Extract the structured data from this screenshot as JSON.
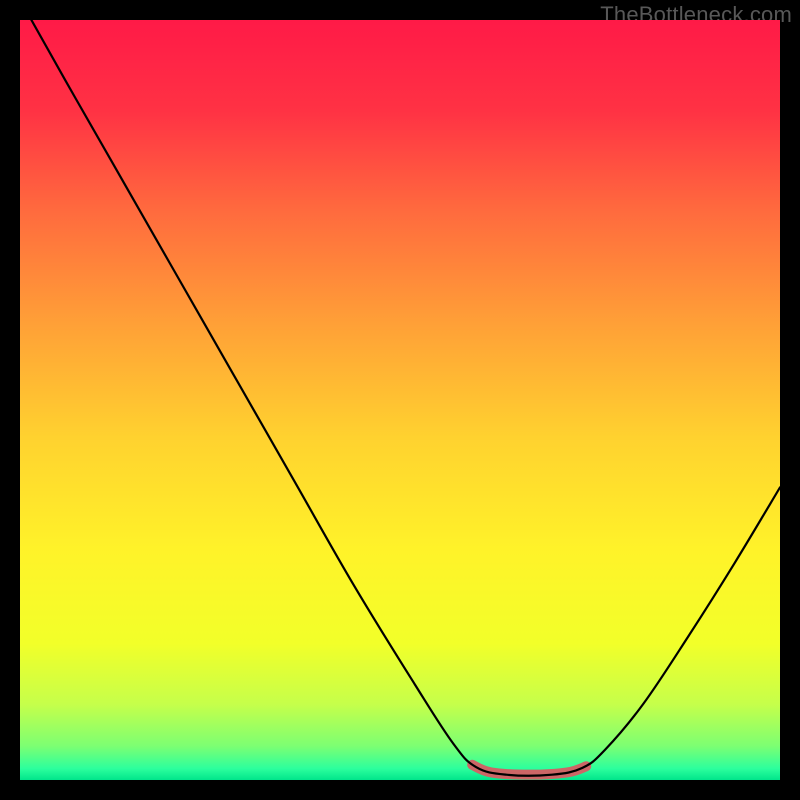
{
  "watermark": "TheBottleneck.com",
  "chart_data": {
    "type": "line",
    "title": "",
    "xlabel": "",
    "ylabel": "",
    "xlim": [
      0,
      100
    ],
    "ylim": [
      0,
      100
    ],
    "background_gradient": {
      "stops": [
        {
          "offset": 0.0,
          "color": "#ff1a47"
        },
        {
          "offset": 0.12,
          "color": "#ff3244"
        },
        {
          "offset": 0.25,
          "color": "#ff6a3e"
        },
        {
          "offset": 0.4,
          "color": "#ffa037"
        },
        {
          "offset": 0.55,
          "color": "#ffd22f"
        },
        {
          "offset": 0.7,
          "color": "#fff329"
        },
        {
          "offset": 0.82,
          "color": "#f2ff29"
        },
        {
          "offset": 0.9,
          "color": "#c6ff4a"
        },
        {
          "offset": 0.955,
          "color": "#7dff72"
        },
        {
          "offset": 0.985,
          "color": "#2cff9d"
        },
        {
          "offset": 1.0,
          "color": "#00e58b"
        }
      ]
    },
    "series": [
      {
        "name": "bottleneck-curve",
        "stroke": "#000000",
        "stroke_width": 2.2,
        "points": [
          {
            "x": 1.5,
            "y": 100.0
          },
          {
            "x": 6.0,
            "y": 92.0
          },
          {
            "x": 12.0,
            "y": 81.5
          },
          {
            "x": 20.0,
            "y": 67.5
          },
          {
            "x": 28.0,
            "y": 53.5
          },
          {
            "x": 36.0,
            "y": 39.5
          },
          {
            "x": 44.0,
            "y": 25.5
          },
          {
            "x": 52.0,
            "y": 12.5
          },
          {
            "x": 57.0,
            "y": 4.8
          },
          {
            "x": 60.0,
            "y": 1.7
          },
          {
            "x": 64.0,
            "y": 0.7
          },
          {
            "x": 70.0,
            "y": 0.7
          },
          {
            "x": 74.0,
            "y": 1.6
          },
          {
            "x": 77.0,
            "y": 4.0
          },
          {
            "x": 82.0,
            "y": 10.0
          },
          {
            "x": 88.0,
            "y": 19.0
          },
          {
            "x": 94.0,
            "y": 28.5
          },
          {
            "x": 100.0,
            "y": 38.5
          }
        ]
      }
    ],
    "highlight_segment": {
      "stroke": "#cc6666",
      "stroke_width": 10,
      "points": [
        {
          "x": 59.5,
          "y": 2.0
        },
        {
          "x": 62.0,
          "y": 1.0
        },
        {
          "x": 67.0,
          "y": 0.7
        },
        {
          "x": 72.0,
          "y": 1.0
        },
        {
          "x": 74.5,
          "y": 1.8
        }
      ]
    }
  }
}
